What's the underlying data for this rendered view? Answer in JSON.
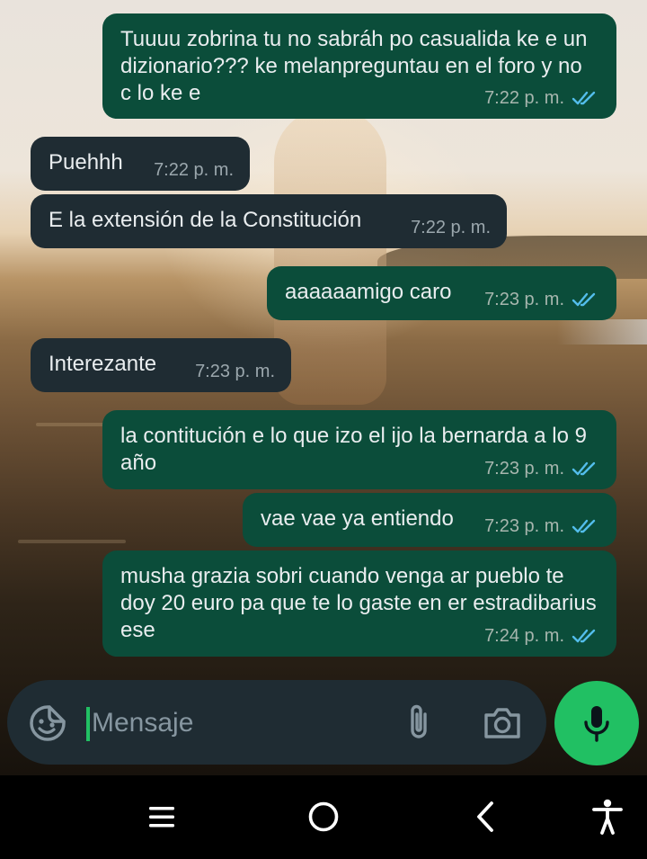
{
  "messages": [
    {
      "dir": "out",
      "text": "Tuuuu zobrina tu no sabráh po casualida ke e un dizionario??? ke melanpreguntau en el foro y no c lo ke e",
      "time": "7:22 p. m.",
      "read": true
    },
    {
      "dir": "in",
      "text": "Puehhh",
      "time": "7:22 p. m."
    },
    {
      "dir": "in",
      "text": "E la extensión de la Constitución",
      "time": "7:22 p. m."
    },
    {
      "dir": "out",
      "text": "aaaaaamigo caro",
      "time": "7:23 p. m.",
      "read": true
    },
    {
      "dir": "in",
      "text": "Interezante",
      "time": "7:23 p. m."
    },
    {
      "dir": "out",
      "text": "la contitución e lo que izo el ijo la bernarda a lo 9 año",
      "time": "7:23 p. m.",
      "read": true
    },
    {
      "dir": "out",
      "text": "vae vae ya entiendo",
      "time": "7:23 p. m.",
      "read": true
    },
    {
      "dir": "out",
      "text": "musha grazia sobri cuando venga ar pueblo te doy 20 euro pa que te lo gaste en er estradibarius ese",
      "time": "7:24 p. m.",
      "read": true
    }
  ],
  "composer": {
    "placeholder": "Mensaje",
    "icons": [
      "sticker-icon",
      "attach-icon",
      "camera-icon",
      "mic-icon"
    ]
  },
  "colors": {
    "outgoing_bubble": "#0b4d3a",
    "incoming_bubble": "#1f2c33",
    "read_check": "#53bdeb",
    "mic_button": "#21c063"
  },
  "navbar": {
    "icons": [
      "menu-icon",
      "home-icon",
      "back-icon",
      "accessibility-icon"
    ]
  }
}
